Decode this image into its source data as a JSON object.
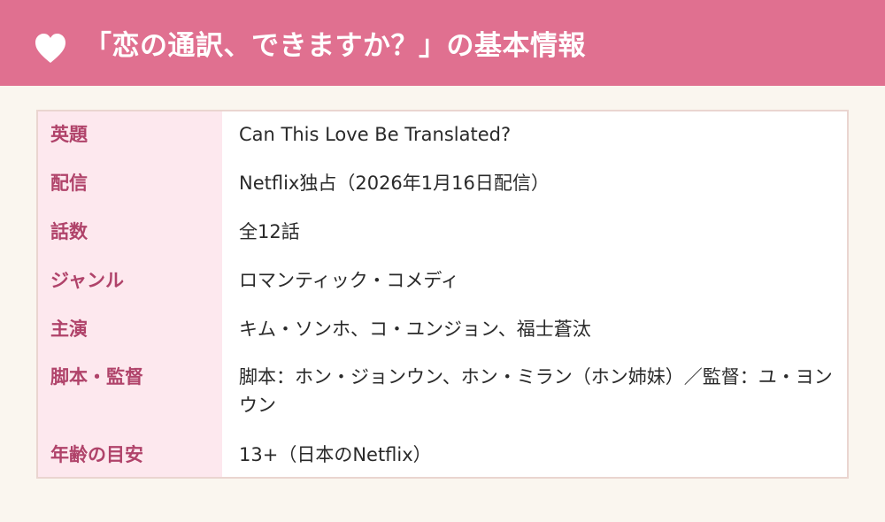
{
  "header": {
    "title": "「恋の通訳、できますか？」の基本情報",
    "icon": "heart-icon",
    "color": "#e07090"
  },
  "rows": [
    {
      "label": "英題",
      "value": "Can This Love Be Translated?"
    },
    {
      "label": "配信",
      "value": "Netflix独占（2026年1月16日配信）"
    },
    {
      "label": "話数",
      "value": "全12話"
    },
    {
      "label": "ジャンル",
      "value": "ロマンティック・コメディ"
    },
    {
      "label": "主演",
      "value": "キム・ソンホ、コ・ユンジョン、福士蒼汰"
    },
    {
      "label": "脚本・監督",
      "value": "脚本：ホン・ジョンウン、ホン・ミラン（ホン姉妹）／監督：ユ・ヨンウン"
    },
    {
      "label": "年齢の目安",
      "value": "13+（日本のNetflix）"
    }
  ]
}
